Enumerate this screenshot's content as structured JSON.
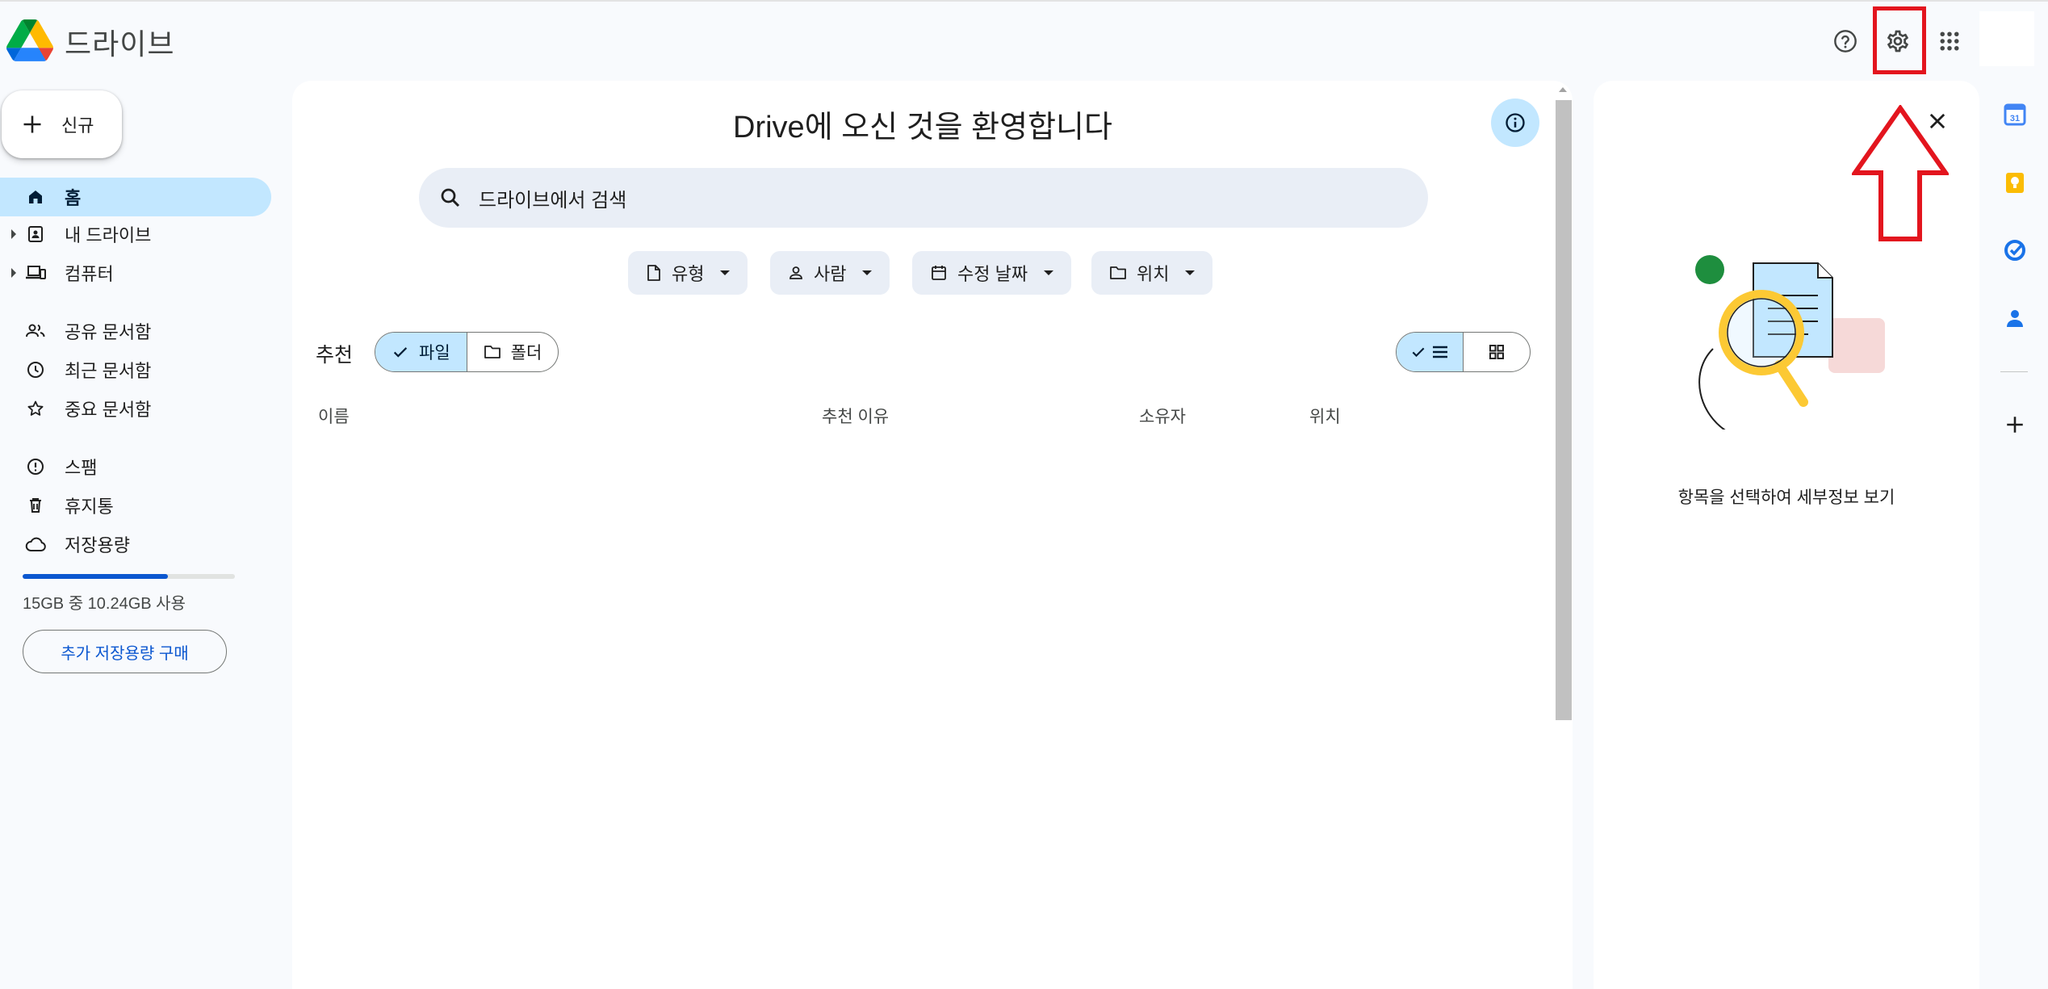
{
  "app": {
    "title": "드라이브"
  },
  "header": {
    "help_icon": "help-icon",
    "settings_icon": "gear-icon",
    "apps_icon": "apps-grid-icon"
  },
  "sidebar": {
    "new_button": "신규",
    "items": [
      {
        "label": "홈",
        "icon": "home-icon",
        "active": true
      },
      {
        "label": "내 드라이브",
        "icon": "my-drive-icon"
      },
      {
        "label": "컴퓨터",
        "icon": "computer-icon"
      },
      {
        "label": "공유 문서함",
        "icon": "shared-icon"
      },
      {
        "label": "최근 문서함",
        "icon": "clock-icon"
      },
      {
        "label": "중요 문서함",
        "icon": "star-icon"
      },
      {
        "label": "스팸",
        "icon": "spam-icon"
      },
      {
        "label": "휴지통",
        "icon": "trash-icon"
      },
      {
        "label": "저장용량",
        "icon": "cloud-icon"
      }
    ],
    "storage": {
      "text": "15GB 중 10.24GB 사용",
      "used_fraction": 0.683
    },
    "buy_storage": "추가 저장용량 구매"
  },
  "main": {
    "title": "Drive에 오신 것을 환영합니다",
    "search_placeholder": "드라이브에서 검색",
    "filters": [
      "유형",
      "사람",
      "수정 날짜",
      "위치"
    ],
    "recommended_label": "추천",
    "segments": {
      "files": "파일",
      "folders": "폴더"
    },
    "columns": {
      "name": "이름",
      "reason": "추천 이유",
      "owner": "소유자",
      "location": "위치"
    }
  },
  "details": {
    "empty_text": "항목을 선택하여 세부정보 보기"
  },
  "colors": {
    "accent": "#0b57d0",
    "selected": "#c2e7ff",
    "highlight": "#e3151e"
  }
}
